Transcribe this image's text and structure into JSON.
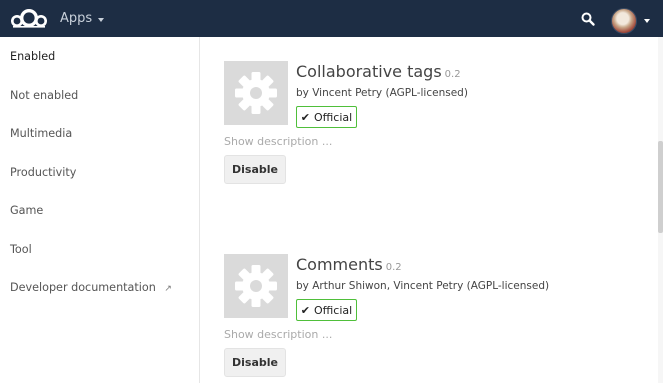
{
  "header": {
    "app_menu_label": "Apps"
  },
  "sidebar": {
    "items": [
      {
        "label": "Enabled"
      },
      {
        "label": "Not enabled"
      },
      {
        "label": "Multimedia"
      },
      {
        "label": "Productivity"
      },
      {
        "label": "Game"
      },
      {
        "label": "Tool"
      },
      {
        "label": "Developer documentation"
      }
    ],
    "external_link_icon": "↗"
  },
  "apps": [
    {
      "name": "Collaborative tags",
      "version": "0.2",
      "author": "by Vincent Petry (AGPL-licensed)",
      "badge": "Official",
      "show_description": "Show description ...",
      "action": "Disable"
    },
    {
      "name": "Comments",
      "version": "0.2",
      "author": "by Arthur Shiwon, Vincent Petry (AGPL-licensed)",
      "badge": "Official",
      "show_description": "Show description ...",
      "action": "Disable"
    }
  ],
  "icons": {
    "logo": "cloud-logo-icon",
    "search": "search-icon",
    "app": "gear-icon",
    "badge": "checkmark-icon"
  },
  "colors": {
    "header_bg": "#1d2d44",
    "official_border": "#4fbf3a"
  }
}
